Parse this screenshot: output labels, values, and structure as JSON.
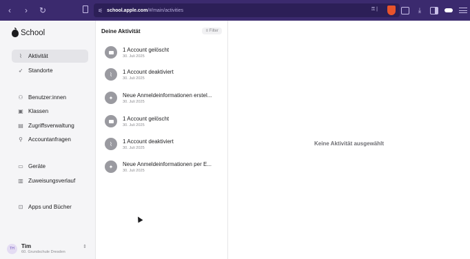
{
  "browser": {
    "url_host": "school.apple.com",
    "url_path": "/#/main/activities"
  },
  "sidebar": {
    "brand": "School",
    "items": [
      {
        "label": "Aktivität",
        "icon": "activity-icon",
        "active": true
      },
      {
        "label": "Standorte",
        "icon": "location-arrow-icon"
      },
      {
        "label": "Benutzer:innen",
        "icon": "users-icon"
      },
      {
        "label": "Klassen",
        "icon": "classes-icon"
      },
      {
        "label": "Zugriffsverwaltung",
        "icon": "access-card-icon"
      },
      {
        "label": "Accountanfragen",
        "icon": "person-add-icon"
      },
      {
        "label": "Geräte",
        "icon": "devices-icon"
      },
      {
        "label": "Zuweisungsverlauf",
        "icon": "list-icon"
      },
      {
        "label": "Apps und Bücher",
        "icon": "apps-icon"
      }
    ],
    "user": {
      "initials": "TH",
      "name": "Tim",
      "school": "60. Grundschule Dresden"
    }
  },
  "activities": {
    "title": "Deine Aktivität",
    "filter_label": "Filter",
    "items": [
      {
        "title": "1 Account gelöscht",
        "date": "30. Juli 2025",
        "type": "deleted"
      },
      {
        "title": "1 Account deaktiviert",
        "date": "30. Juli 2025",
        "type": "deactivated"
      },
      {
        "title": "Neue Anmeldeinformationen erstel...",
        "date": "30. Juli 2025",
        "type": "credentials"
      },
      {
        "title": "1 Account gelöscht",
        "date": "30. Juli 2025",
        "type": "deleted"
      },
      {
        "title": "1 Account deaktiviert",
        "date": "30. Juli 2025",
        "type": "deactivated"
      },
      {
        "title": "Neue Anmeldeinformationen per E...",
        "date": "30. Juli 2025",
        "type": "credentials"
      }
    ]
  },
  "detail": {
    "empty_message": "Keine Aktivität ausgewählt"
  }
}
